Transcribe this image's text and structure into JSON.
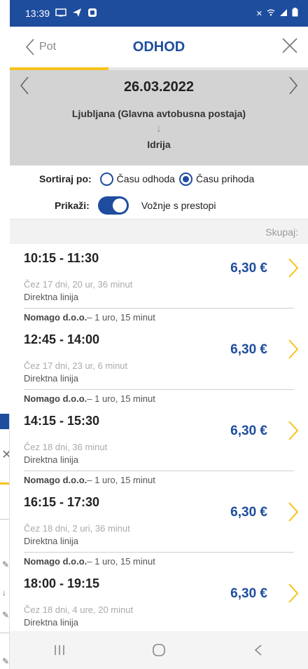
{
  "status_bar": {
    "time": "13:39",
    "left_icons": [
      "cast-icon",
      "navigation-arrow-icon",
      "app-icon"
    ],
    "right_icons": [
      "mute-icon",
      "wifi-icon",
      "signal-icon",
      "battery-icon"
    ]
  },
  "header": {
    "back_label": "Pot",
    "title": "ODHOD",
    "progress_fraction": 0.33
  },
  "date_bar": {
    "date": "26.03.2022",
    "from": "Ljubljana (Glavna avtobusna postaja)",
    "arrow": "↓",
    "to": "Idrija"
  },
  "sort": {
    "label": "Sortiraj po:",
    "options": [
      {
        "label": "Času odhoda",
        "selected": false
      },
      {
        "label": "Času prihoda",
        "selected": true
      }
    ]
  },
  "show": {
    "label": "Prikaži:",
    "toggle_on": true,
    "toggle_label": "Vožnje s prestopi"
  },
  "list_header": {
    "total_label": "Skupaj:"
  },
  "trips": [
    {
      "operator": "",
      "duration": "",
      "time": "10:15 - 11:30",
      "eta": "Čez 17 dni, 20 ur, 36 minut",
      "type": "Direktna linija",
      "price": "6,30 €"
    },
    {
      "operator": "Nomago d.o.o.",
      "duration": " – 1 uro, 15 minut",
      "time": "12:45 - 14:00",
      "eta": "Čez 17 dni, 23 ur, 6 minut",
      "type": "Direktna linija",
      "price": "6,30 €"
    },
    {
      "operator": "Nomago d.o.o.",
      "duration": " – 1 uro, 15 minut",
      "time": "14:15 - 15:30",
      "eta": "Čez 18 dni, 36 minut",
      "type": "Direktna linija",
      "price": "6,30 €"
    },
    {
      "operator": "Nomago d.o.o.",
      "duration": " – 1 uro, 15 minut",
      "time": "16:15 - 17:30",
      "eta": "Čez 18 dni, 2 uri, 36 minut",
      "type": "Direktna linija",
      "price": "6,30 €"
    },
    {
      "operator": "Nomago d.o.o.",
      "duration": " – 1 uro, 15 minut",
      "time": "18:00 - 19:15",
      "eta": "Čez 18 dni, 4 ure, 20 minut",
      "type": "Direktna linija",
      "price": "6,30 €"
    }
  ],
  "colors": {
    "brand_blue": "#1e4d9e",
    "accent_yellow": "#f6c21a",
    "date_bar_gray": "#d3d3d3"
  },
  "nav_bar": {
    "buttons": [
      "recents-icon",
      "home-icon",
      "back-icon"
    ]
  }
}
